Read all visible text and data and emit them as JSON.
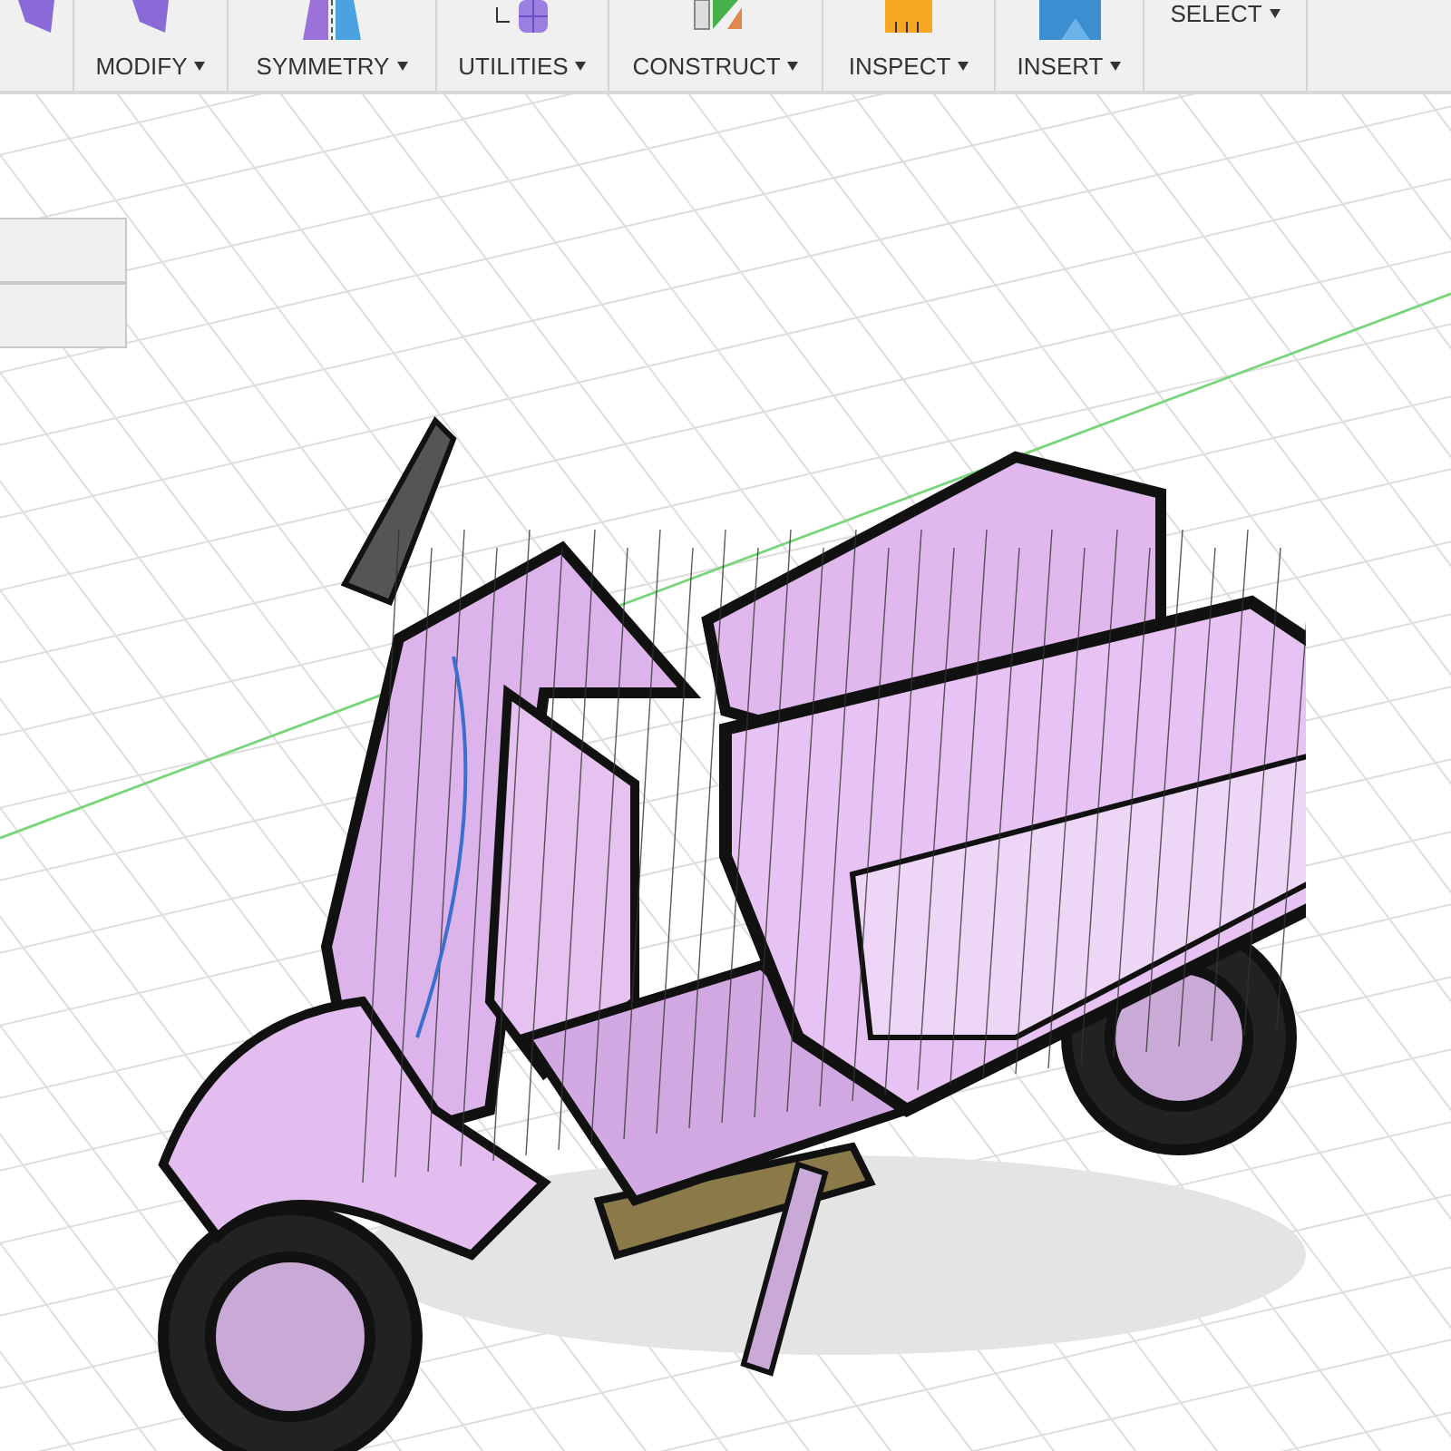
{
  "toolbar": {
    "groups": [
      {
        "label": "MODIFY"
      },
      {
        "label": "SYMMETRY"
      },
      {
        "label": "UTILITIES"
      },
      {
        "label": "CONSTRUCT"
      },
      {
        "label": "INSPECT"
      },
      {
        "label": "INSERT"
      },
      {
        "label": "SELECT"
      }
    ]
  }
}
